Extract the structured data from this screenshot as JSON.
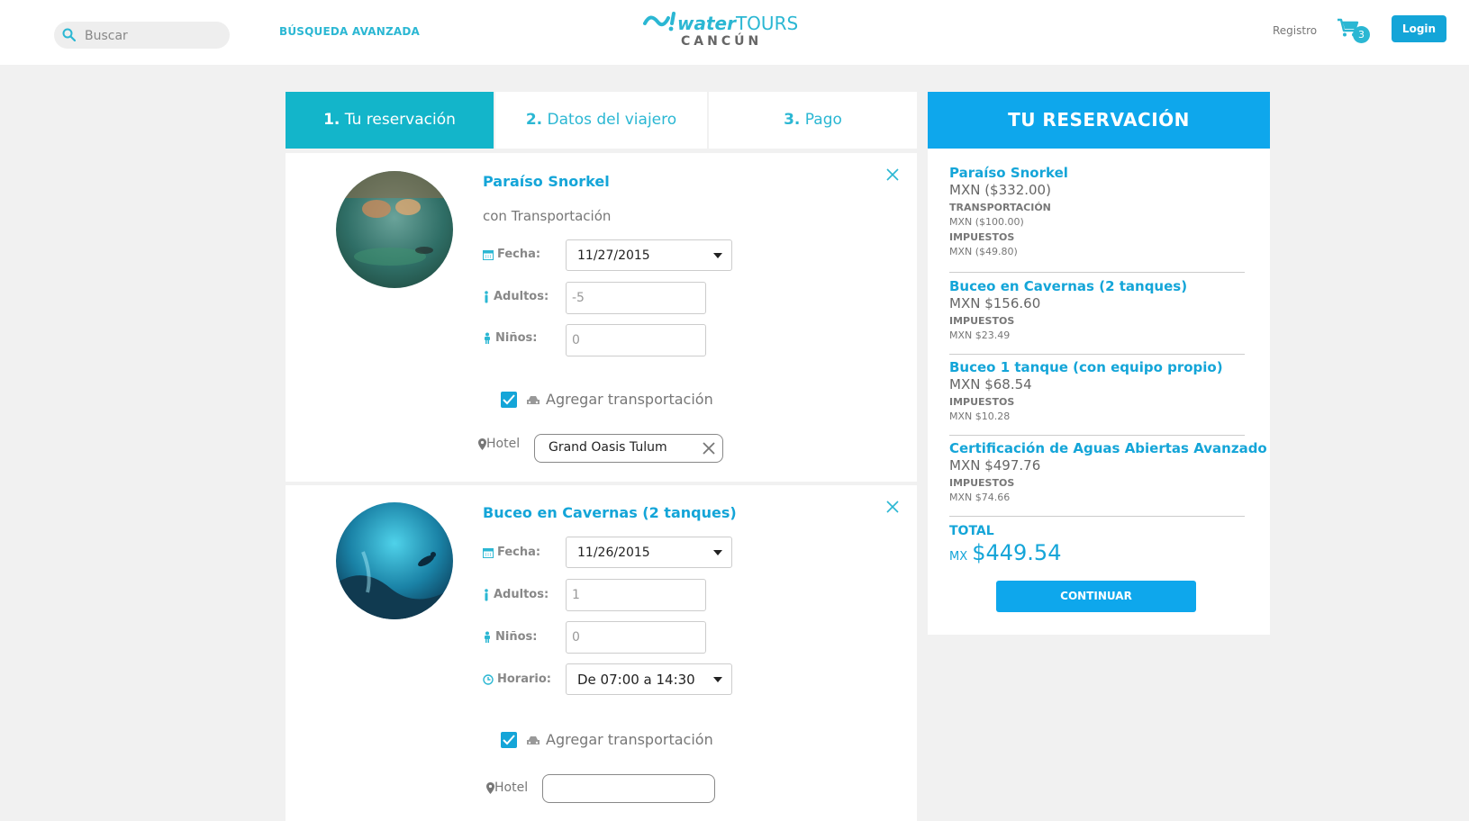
{
  "header": {
    "search_placeholder": "Buscar",
    "advanced_search": "BÚSQUEDA AVANZADA",
    "logo": {
      "brand_a": "water",
      "brand_b": "TOURS",
      "city": "CANCÚN"
    },
    "registro": "Registro",
    "cart_count": "3",
    "login": "Login"
  },
  "steps": [
    {
      "num": "1.",
      "label": "Tu reservación",
      "active": true
    },
    {
      "num": "2.",
      "label": "Datos del viajero",
      "active": false
    },
    {
      "num": "3.",
      "label": "Pago",
      "active": false
    }
  ],
  "bookings": [
    {
      "title": "Paraíso Snorkel",
      "subtitle": "con Transportación",
      "fecha_label": "Fecha:",
      "fecha": "11/27/2015",
      "adultos_label": "Adultos:",
      "adultos": "-5",
      "ninos_label": "Niños:",
      "ninos": "0",
      "transport_label": "Agregar transportación",
      "transport_checked": true,
      "hotel_label": "Hotel",
      "hotel": "Grand Oasis Tulum"
    },
    {
      "title": "Buceo en Cavernas (2 tanques)",
      "fecha_label": "Fecha:",
      "fecha": "11/26/2015",
      "adultos_label": "Adultos:",
      "adultos": "1",
      "ninos_label": "Niños:",
      "ninos": "0",
      "horario_label": "Horario:",
      "horario": "De 07:00 a 14:30",
      "transport_label": "Agregar transportación",
      "transport_checked": true,
      "hotel_label": "Hotel",
      "hotel": ""
    }
  ],
  "summary": {
    "title": "TU RESERVACIÓN",
    "items": [
      {
        "name": "Paraíso Snorkel",
        "price": "MXN ($332.00)",
        "transport_label": "TRANSPORTACIÓN",
        "transport": "MXN ($100.00)",
        "tax_label": "IMPUESTOS",
        "tax": "MXN ($49.80)"
      },
      {
        "name": "Buceo en Cavernas (2 tanques)",
        "price": "MXN $156.60",
        "tax_label": "IMPUESTOS",
        "tax": "MXN $23.49"
      },
      {
        "name": "Buceo 1 tanque (con equipo propio)",
        "price": "MXN $68.54",
        "tax_label": "IMPUESTOS",
        "tax": "MXN $10.28"
      },
      {
        "name": "Certificación de Aguas Abiertas Avanzado",
        "price": "MXN $497.76",
        "tax_label": "IMPUESTOS",
        "tax": "MXN $74.66"
      }
    ],
    "total_label": "TOTAL",
    "total_currency": "MX",
    "total_amount": "$449.54",
    "continue": "CONTINUAR"
  },
  "colors": {
    "accent": "#14a5d8",
    "step_active": "#13b5ca",
    "summary_header": "#0ea7ec"
  }
}
